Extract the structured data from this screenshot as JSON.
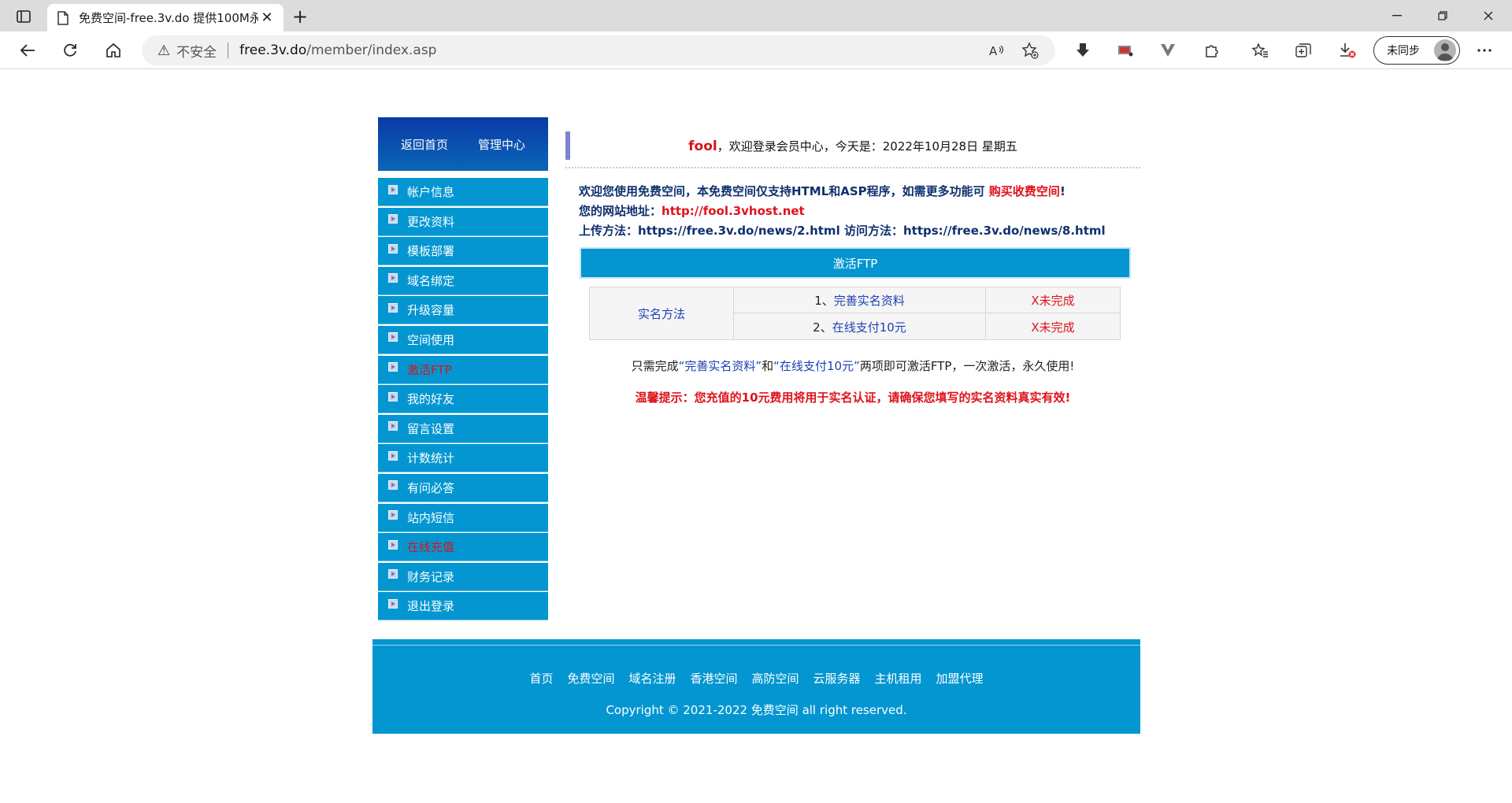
{
  "browser": {
    "tab_title": "免费空间-free.3v.do 提供100M永",
    "tab_close": "✕",
    "new_tab": "+",
    "security_label": "不安全",
    "url_host": "free.3v.do",
    "url_path": "/member/index.asp",
    "sync_label": "未同步"
  },
  "sidebar": {
    "head": {
      "home": "返回首页",
      "admin": "管理中心"
    },
    "items": [
      {
        "label": "帐户信息"
      },
      {
        "label": "更改资料"
      },
      {
        "label": "模板部署"
      },
      {
        "label": "域名绑定"
      },
      {
        "label": "升级容量"
      },
      {
        "label": "空间使用"
      },
      {
        "label": "激活FTP"
      },
      {
        "label": "我的好友"
      },
      {
        "label": "留言设置"
      },
      {
        "label": "计数统计"
      },
      {
        "label": "有问必答"
      },
      {
        "label": "站内短信"
      },
      {
        "label": "在线充值"
      },
      {
        "label": "财务记录"
      },
      {
        "label": "退出登录"
      }
    ]
  },
  "main": {
    "welcome": {
      "username": "fool",
      "text": "，欢迎登录会员中心，今天是：2022年10月28日 星期五"
    },
    "info": {
      "line1_prefix": "欢迎您使用免费空间，本免费空间仅支持HTML和ASP程序，如需更多功能可",
      "line1_link": "购买收费空间",
      "line1_suffix": "!",
      "line2_label": "您的网站地址：",
      "line2_url": "http://fool.3vhost.net",
      "line3_upload_label": "上传方法：",
      "line3_upload_url": "https://free.3v.do/news/2.html",
      "line3_visit_label": "访问方法：",
      "line3_visit_url": "https://free.3v.do/news/8.html"
    },
    "ftp_title": "激活FTP",
    "realname": {
      "label": "实名方法",
      "rows": [
        {
          "num": "1、",
          "link": "完善实名资料",
          "status": "X未完成"
        },
        {
          "num": "2、",
          "link": "在线支付10元",
          "status": "X未完成"
        }
      ]
    },
    "note": {
      "prefix": "只需完成",
      "q1": "“完善实名资料”",
      "mid": "和",
      "q2": "“在线支付10元”",
      "suffix": "两项即可激活FTP，一次激活，永久使用!"
    },
    "tip": "温馨提示：您充值的10元费用将用于实名认证，请确保您填写的实名资料真实有效!"
  },
  "footer": {
    "links": [
      "首页",
      "免费空间",
      "域名注册",
      "香港空间",
      "高防空间",
      "云服务器",
      "主机租用",
      "加盟代理"
    ],
    "copyright": "Copyright © 2021-2022 免费空间 all right reserved."
  },
  "colors": {
    "menu_blue": "#0396d1",
    "header_blue": "#0a3aa6",
    "accent_red": "#e0121b",
    "link_blue": "#1e3fb5"
  }
}
